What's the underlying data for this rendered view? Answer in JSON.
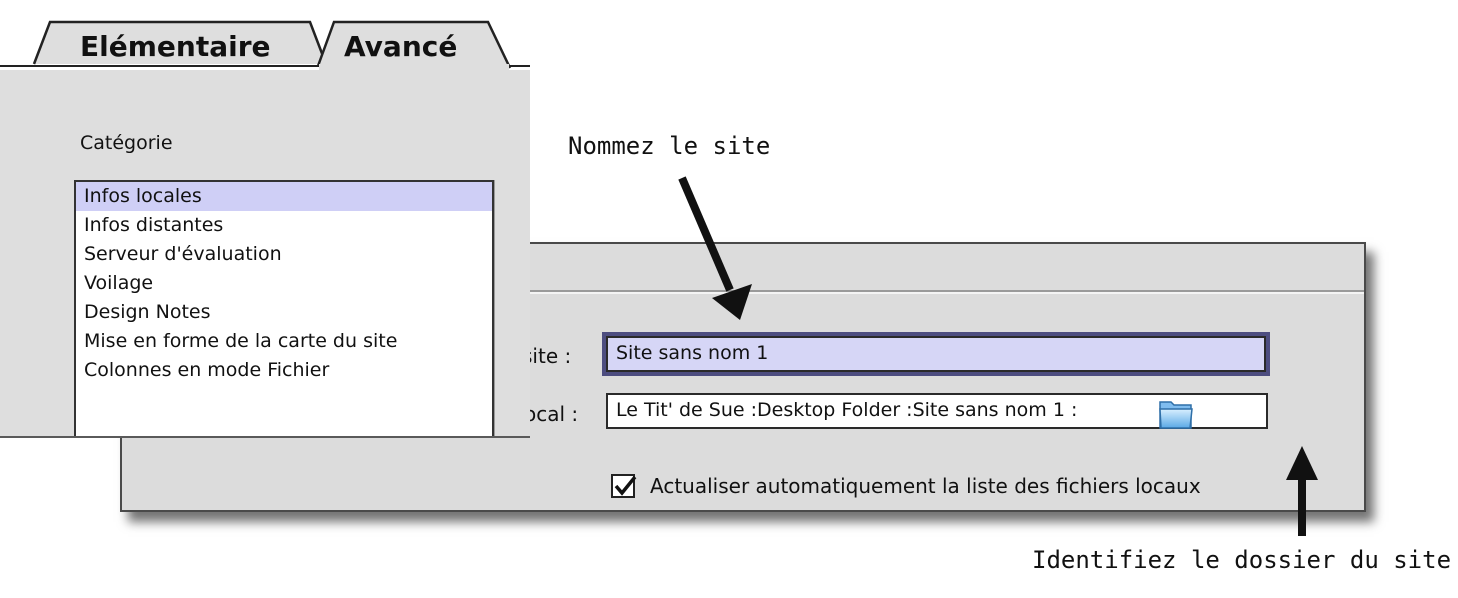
{
  "tabs": [
    {
      "label": "Elémentaire",
      "active": false
    },
    {
      "label": "Avancé",
      "active": true
    }
  ],
  "category": {
    "label": "Catégorie",
    "items": [
      {
        "label": "Infos locales",
        "selected": true
      },
      {
        "label": "Infos distantes",
        "selected": false
      },
      {
        "label": "Serveur d'évaluation",
        "selected": false
      },
      {
        "label": "Voilage",
        "selected": false
      },
      {
        "label": "Design Notes",
        "selected": false
      },
      {
        "label": "Mise en forme de la carte du site",
        "selected": false
      },
      {
        "label": "Colonnes en mode Fichier",
        "selected": false
      }
    ]
  },
  "form": {
    "site_name_label": "site :",
    "site_name_value": "Site sans nom 1",
    "local_folder_label": "ocal :",
    "local_folder_value": "Le Tit' de Sue :Desktop Folder :Site sans nom 1 :",
    "auto_refresh_label": "Actualiser automatiquement la liste des fichiers locaux",
    "auto_refresh_checked": true
  },
  "annotations": {
    "name_site": "Nommez le site",
    "identify_folder": "Identifiez le dossier du site"
  },
  "icons": {
    "folder": "folder-icon",
    "checkmark": "checkmark-icon"
  },
  "colors": {
    "panel_bg": "#dedede",
    "selection": "#cfcff6",
    "focus_field": "#d6d6f6",
    "focus_ring": "#4d4d80"
  }
}
